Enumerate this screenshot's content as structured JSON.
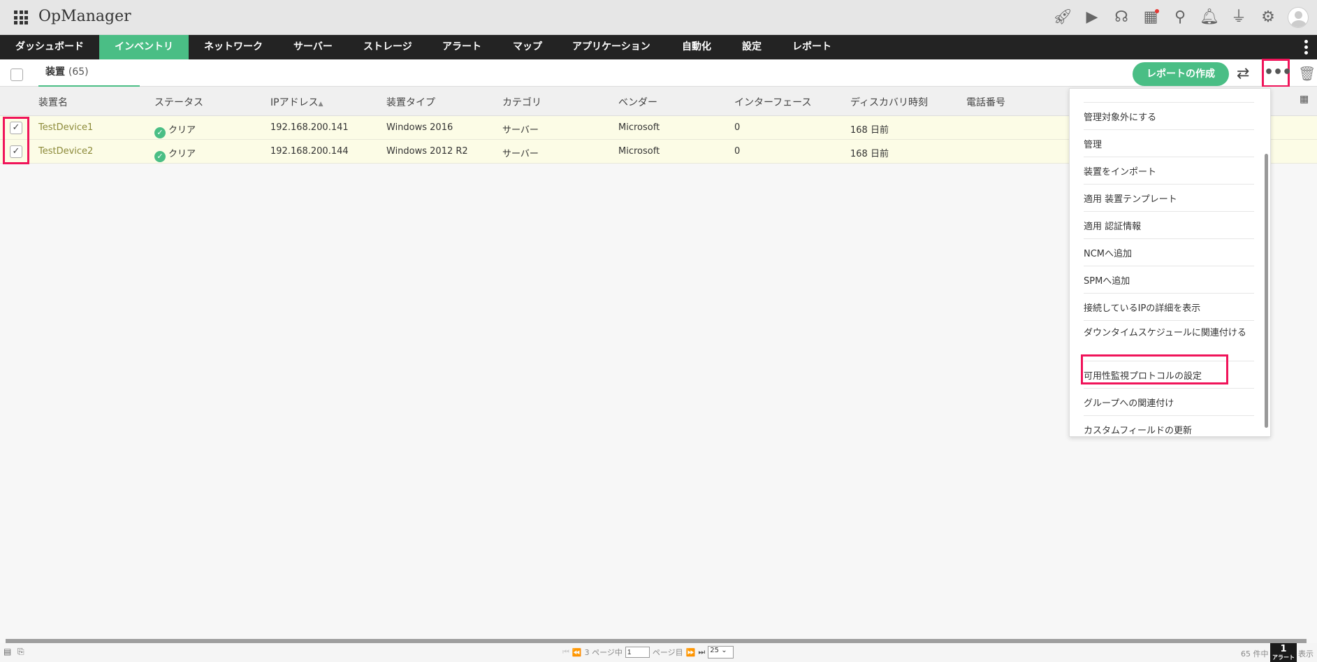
{
  "app": {
    "title": "OpManager"
  },
  "header_icons": [
    "rocket-icon",
    "presentation-icon",
    "headset-icon",
    "gift-icon",
    "search-icon",
    "bell-icon",
    "plug-icon",
    "gear-icon",
    "user-avatar-icon"
  ],
  "nav": {
    "items": [
      "ダッシュボード",
      "インベントリ",
      "ネットワーク",
      "サーバー",
      "ストレージ",
      "アラート",
      "マップ",
      "アプリケーション",
      "自動化",
      "設定",
      "レポート"
    ],
    "active": "インベントリ"
  },
  "toolbar": {
    "tab_label": "装置",
    "tab_count": "(65)",
    "report_button": "レポートの作成"
  },
  "table": {
    "columns": [
      "装置名",
      "ステータス",
      "IPアドレス",
      "装置タイプ",
      "カテゴリ",
      "ベンダー",
      "インターフェース",
      "ディスカバリ時刻",
      "電話番号"
    ],
    "rows": [
      {
        "name": "TestDevice1",
        "status": "クリア",
        "ip": "192.168.200.141",
        "type": "Windows 2016",
        "category": "サーバー",
        "vendor": "Microsoft",
        "interfaces": "0",
        "discovered": "168 日前",
        "checked": true
      },
      {
        "name": "TestDevice2",
        "status": "クリア",
        "ip": "192.168.200.144",
        "type": "Windows 2012 R2",
        "category": "サーバー",
        "vendor": "Microsoft",
        "interfaces": "0",
        "discovered": "168 日前",
        "checked": true
      }
    ]
  },
  "menu": {
    "items": [
      "管理対象外にする",
      "管理",
      "装置をインポート",
      "適用 装置テンプレート",
      "適用 認証情報",
      "NCMへ追加",
      "SPMへ追加",
      "接続しているIPの詳細を表示",
      "ダウンタイムスケジュールに関連付ける",
      "可用性監視プロトコルの設定",
      "グループへの関連付け",
      "カスタムフィールドの更新"
    ],
    "highlighted": "可用性監視プロトコルの設定"
  },
  "footer": {
    "page_prefix": "3 ページ中",
    "page_value": "1",
    "page_suffix": "ページ目",
    "page_size": "25",
    "count_text": "65 件中",
    "display_text": "表示",
    "alarm_count": "1",
    "alarm_label": "アラート"
  },
  "colors": {
    "accent": "#4abe85",
    "highlight": "#f0145a",
    "nav_bg": "#232323",
    "row_selected": "#fcfce6"
  }
}
